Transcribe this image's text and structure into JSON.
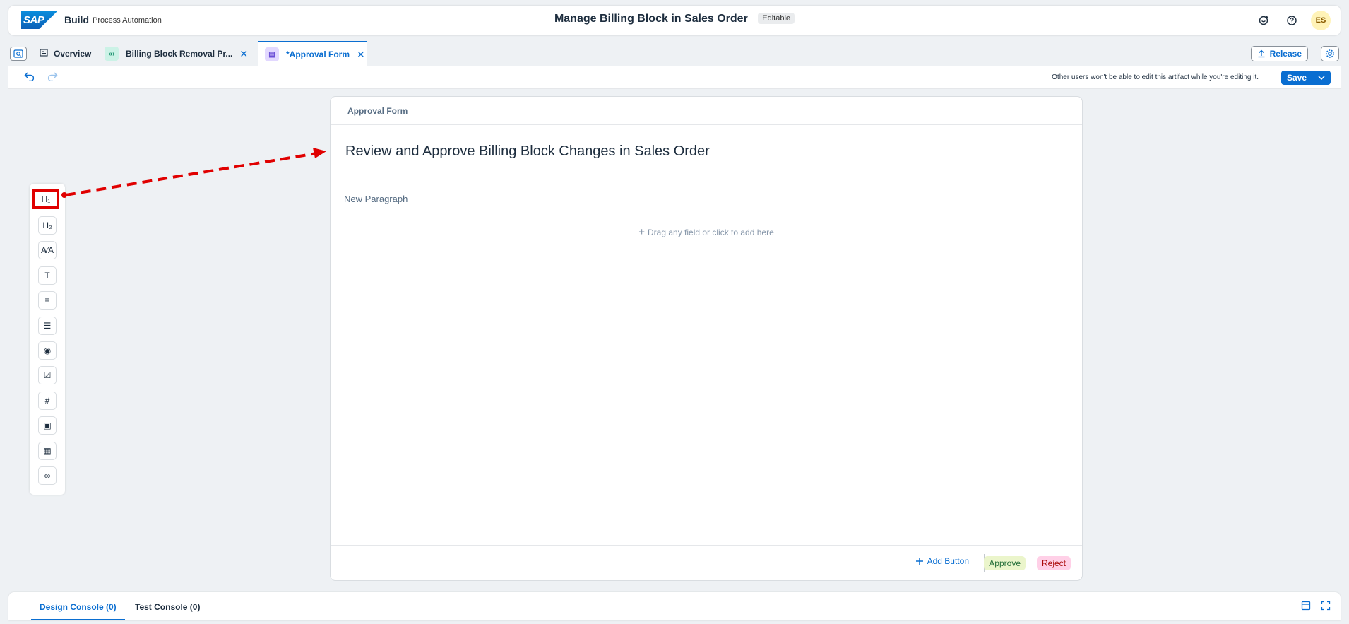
{
  "shell": {
    "brand_logo": "SAP",
    "brand_name": "Build",
    "brand_sub": "Process Automation",
    "title": "Manage Billing Block in Sales Order",
    "status_badge": "Editable",
    "icons": [
      "joule-icon",
      "help-icon"
    ],
    "avatar_initials": "ES"
  },
  "tabs": [
    {
      "label": "Overview",
      "icon": "overview-icon"
    },
    {
      "label": "Billing Block Removal Pr...",
      "icon": "process-icon",
      "closable": true
    },
    {
      "label": "*Approval Form",
      "icon": "form-icon",
      "closable": true,
      "active": true
    }
  ],
  "tab_actions": {
    "release_label": "Release",
    "settings_icon": "gear-icon"
  },
  "toolbar": {
    "lock_note": "Other users won't be able to edit this artifact while you're editing it.",
    "save_label": "Save"
  },
  "palette": {
    "items": [
      {
        "name": "heading-1",
        "glyph": "H₁",
        "selected": true
      },
      {
        "name": "heading-2",
        "glyph": "H₂"
      },
      {
        "name": "paragraph",
        "glyph": "A⁄A"
      },
      {
        "name": "text",
        "glyph": "T"
      },
      {
        "name": "text-area",
        "glyph": "≡"
      },
      {
        "name": "dropdown",
        "glyph": "☰"
      },
      {
        "name": "radio",
        "glyph": "◉"
      },
      {
        "name": "checkbox",
        "glyph": "☑"
      },
      {
        "name": "number",
        "glyph": "#"
      },
      {
        "name": "date",
        "glyph": "▣"
      },
      {
        "name": "table",
        "glyph": "▦"
      },
      {
        "name": "link",
        "glyph": "∞"
      }
    ]
  },
  "form": {
    "header": "Approval Form",
    "heading": "Review and Approve Billing Block Changes in Sales Order",
    "paragraph": "New Paragraph",
    "drop_hint": "Drag any field or click to add here",
    "add_button_label": "Add Button",
    "approve_label": "Approve",
    "reject_label": "Reject"
  },
  "console": {
    "tabs": [
      {
        "label": "Design Console (0)",
        "active": true
      },
      {
        "label": "Test Console (0)"
      }
    ]
  },
  "colors": {
    "accent": "#0a6ed1",
    "annotation": "#e00000",
    "approve_bg": "#ebf5cb",
    "reject_bg": "#ffd0e7"
  }
}
